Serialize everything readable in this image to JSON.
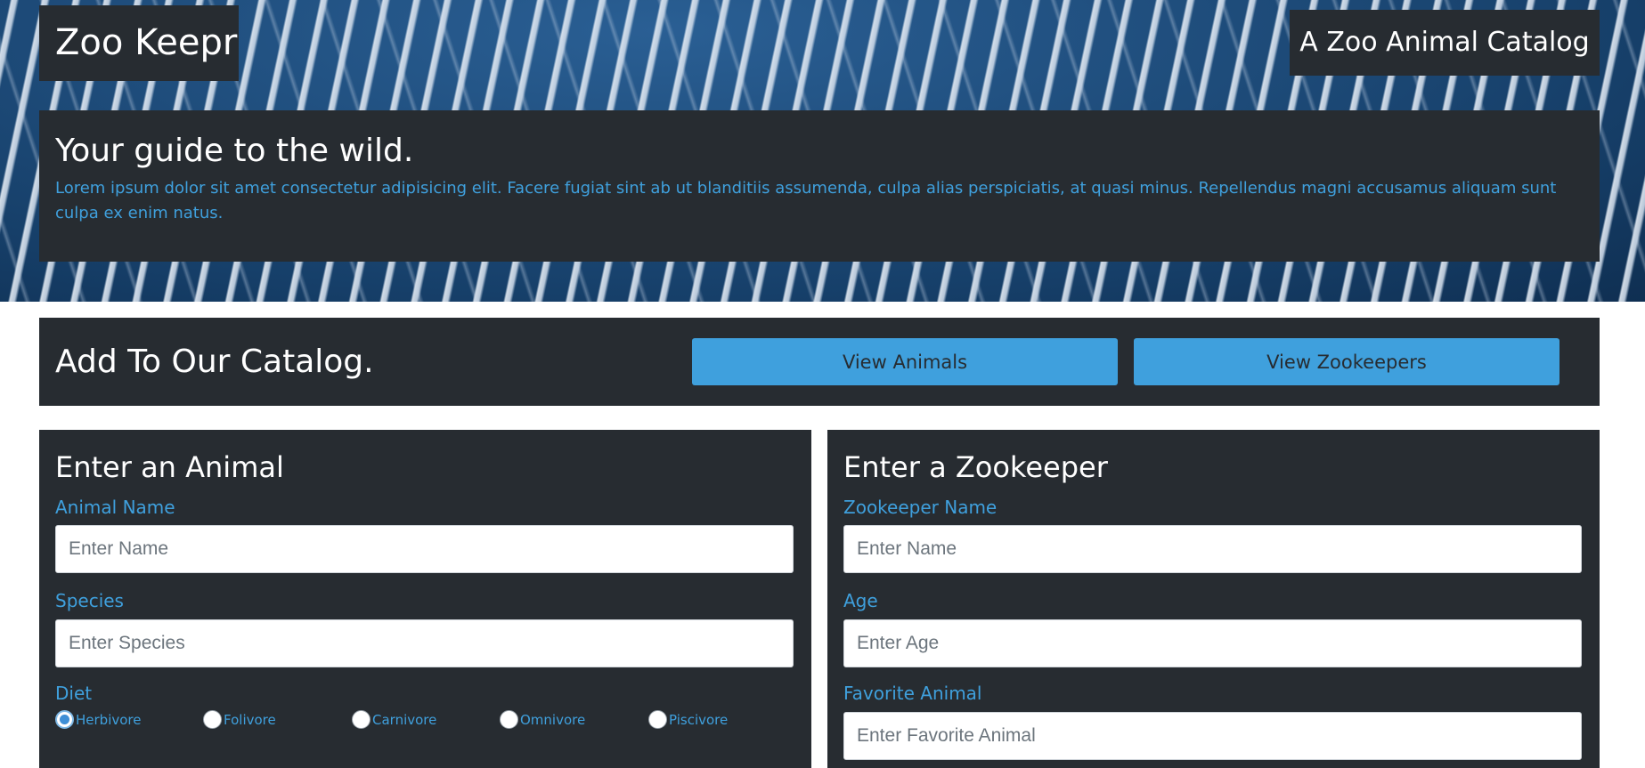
{
  "header": {
    "brand": "Zoo Keepr",
    "tagline": "A Zoo Animal Catalog"
  },
  "intro": {
    "title": "Your guide to the wild.",
    "text": "Lorem ipsum dolor sit amet consectetur adipisicing elit. Facere fugiat sint ab ut blanditiis assumenda, culpa alias perspiciatis, at quasi minus. Repellendus magni accusamus aliquam sunt culpa ex enim natus."
  },
  "catalog": {
    "title": "Add To Our Catalog.",
    "view_animals_label": "View Animals",
    "view_zookeepers_label": "View Zookeepers"
  },
  "animal_form": {
    "title": "Enter an Animal",
    "name_label": "Animal Name",
    "name_placeholder": "Enter Name",
    "species_label": "Species",
    "species_placeholder": "Enter Species",
    "diet_label": "Diet",
    "diet_options": [
      "Herbivore",
      "Folivore",
      "Carnivore",
      "Omnivore",
      "Piscivore"
    ],
    "diet_selected": "Herbivore"
  },
  "zookeeper_form": {
    "title": "Enter a Zookeeper",
    "name_label": "Zookeeper Name",
    "name_placeholder": "Enter Name",
    "age_label": "Age",
    "age_placeholder": "Enter Age",
    "favorite_label": "Favorite Animal",
    "favorite_placeholder": "Enter Favorite Animal"
  },
  "colors": {
    "panel_bg": "#272c31",
    "accent": "#3fa0dd",
    "hero_blue": "#1f4f80"
  }
}
